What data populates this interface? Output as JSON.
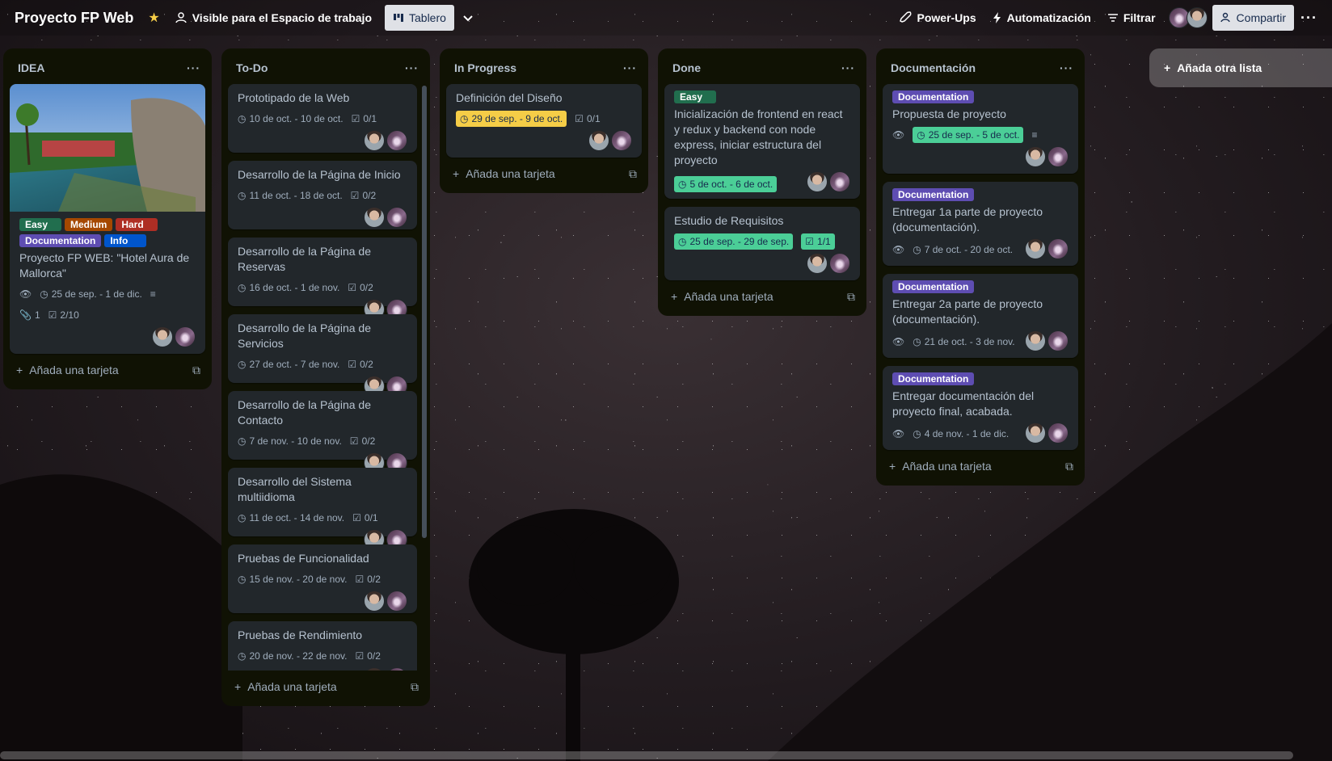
{
  "header": {
    "board_title": "Proyecto FP Web",
    "visibility": "Visible para el Espacio de trabajo",
    "view": "Tablero",
    "power_ups": "Power-Ups",
    "automation": "Automatización",
    "filter": "Filtrar",
    "share": "Compartir"
  },
  "lists": [
    {
      "title": "IDEA",
      "add_card": "Añada una tarjeta",
      "cards": [
        {
          "labels": [
            "Easy",
            "Medium",
            "Hard",
            "Documentation",
            "Info"
          ],
          "title": "Proyecto FP WEB: \"Hotel Aura de Mallorca\"",
          "dates": "25 de sep. - 1 de dic.",
          "attachments": "1",
          "checklist": "2/10"
        }
      ]
    },
    {
      "title": "To-Do",
      "add_card": "Añada una tarjeta",
      "cards": [
        {
          "title": "Prototipado de la Web",
          "dates": "10 de oct. - 10 de oct.",
          "checklist": "0/1"
        },
        {
          "title": "Desarrollo de la Página de Inicio",
          "dates": "11 de oct. - 18 de oct.",
          "checklist": "0/2"
        },
        {
          "title": "Desarrollo de la Página de Reservas",
          "dates": "16 de oct. - 1 de nov.",
          "checklist": "0/2"
        },
        {
          "title": "Desarrollo de la Página de Servicios",
          "dates": "27 de oct. - 7 de nov.",
          "checklist": "0/2"
        },
        {
          "title": "Desarrollo de la Página de Contacto",
          "dates": "7 de nov. - 10 de nov.",
          "checklist": "0/2"
        },
        {
          "title": "Desarrollo del Sistema multiidioma",
          "dates": "11 de oct. - 14 de nov.",
          "checklist": "0/1"
        },
        {
          "title": "Pruebas de Funcionalidad",
          "dates": "15 de nov. - 20 de nov.",
          "checklist": "0/2"
        },
        {
          "title": "Pruebas de Rendimiento",
          "dates": "20 de nov. - 22 de nov.",
          "checklist": "0/2"
        }
      ]
    },
    {
      "title": "In Progress",
      "add_card": "Añada una tarjeta",
      "cards": [
        {
          "title": "Definición del Diseño",
          "dates": "29 de sep. - 9 de oct.",
          "checklist": "0/1"
        }
      ]
    },
    {
      "title": "Done",
      "add_card": "Añada una tarjeta",
      "cards": [
        {
          "label": "Easy",
          "title": "Inicialización de frontend en react y redux y backend con node express, iniciar estructura del proyecto",
          "dates": "5 de oct. - 6 de oct."
        },
        {
          "title": "Estudio de Requisitos",
          "dates": "25 de sep. - 29 de sep.",
          "checklist": "1/1"
        }
      ]
    },
    {
      "title": "Documentación",
      "add_card": "Añada una tarjeta",
      "cards": [
        {
          "label": "Documentation",
          "title": "Propuesta de proyecto",
          "dates": "25 de sep. - 5 de oct."
        },
        {
          "label": "Documentation",
          "title": "Entregar 1a parte de proyecto (documentación).",
          "dates": "7 de oct. - 20 de oct."
        },
        {
          "label": "Documentation",
          "title": "Entregar 2a parte de proyecto (documentación).",
          "dates": "21 de oct. - 3 de nov."
        },
        {
          "label": "Documentation",
          "title": "Entregar documentación del proyecto final, acabada.",
          "dates": "4 de nov. - 1 de dic."
        }
      ]
    }
  ],
  "add_list": "Añada otra lista",
  "colors": {
    "list_bg": "#101204",
    "card_bg": "#22272b",
    "due_yellow": "#f5cd47",
    "due_green": "#4bce97",
    "label_documentation": "#5e4db2"
  }
}
